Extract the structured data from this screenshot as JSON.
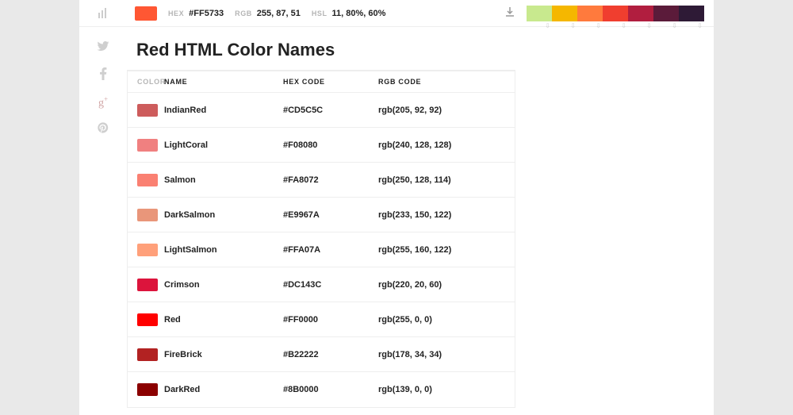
{
  "topbar": {
    "main_swatch": "#FF5733",
    "hex_label": "HEX",
    "hex_value": "#FF5733",
    "rgb_label": "RGB",
    "rgb_value": "255, 87, 51",
    "hsl_label": "HSL",
    "hsl_value": "11, 80%, 60%",
    "palette": [
      "#C8E98E",
      "#F5B700",
      "#FF7A3D",
      "#F03E2F",
      "#B11E3F",
      "#5B1B3A",
      "#2E1A36"
    ]
  },
  "title": "Red HTML Color Names",
  "headers": {
    "color": "COLOR",
    "name": "NAME",
    "hex": "HEX CODE",
    "rgb": "RGB CODE"
  },
  "rows": [
    {
      "swatch": "#CD5C5C",
      "name": "IndianRed",
      "hex": "#CD5C5C",
      "rgb": "rgb(205, 92, 92)"
    },
    {
      "swatch": "#F08080",
      "name": "LightCoral",
      "hex": "#F08080",
      "rgb": "rgb(240, 128, 128)"
    },
    {
      "swatch": "#FA8072",
      "name": "Salmon",
      "hex": "#FA8072",
      "rgb": "rgb(250, 128, 114)"
    },
    {
      "swatch": "#E9967A",
      "name": "DarkSalmon",
      "hex": "#E9967A",
      "rgb": "rgb(233, 150, 122)"
    },
    {
      "swatch": "#FFA07A",
      "name": "LightSalmon",
      "hex": "#FFA07A",
      "rgb": "rgb(255, 160, 122)"
    },
    {
      "swatch": "#DC143C",
      "name": "Crimson",
      "hex": "#DC143C",
      "rgb": "rgb(220, 20, 60)"
    },
    {
      "swatch": "#FF0000",
      "name": "Red",
      "hex": "#FF0000",
      "rgb": "rgb(255, 0, 0)"
    },
    {
      "swatch": "#B22222",
      "name": "FireBrick",
      "hex": "#B22222",
      "rgb": "rgb(178, 34, 34)"
    },
    {
      "swatch": "#8B0000",
      "name": "DarkRed",
      "hex": "#8B0000",
      "rgb": "rgb(139, 0, 0)"
    }
  ]
}
